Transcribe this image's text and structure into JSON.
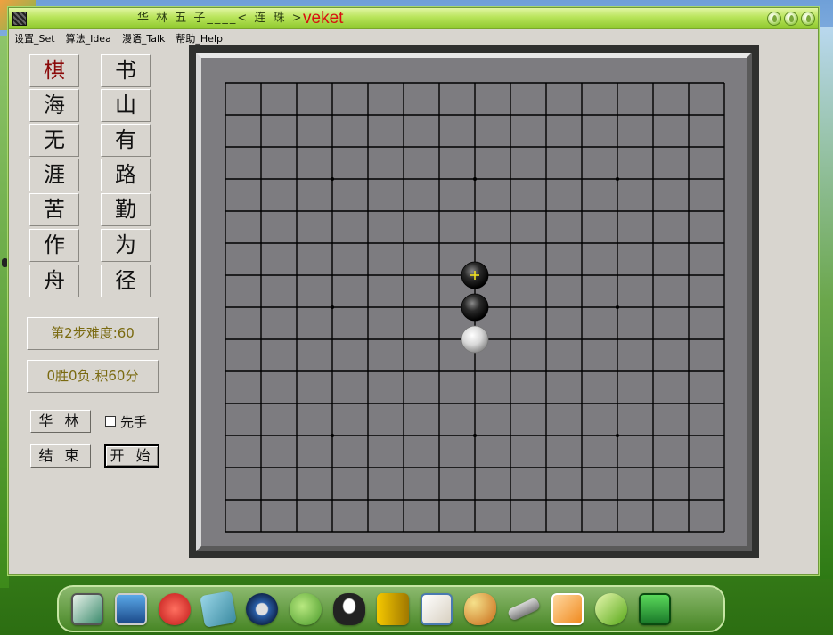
{
  "window": {
    "title": "华 林 五 子____< 连 珠 >",
    "brand": "veket"
  },
  "menu": [
    {
      "label": "设置_Set"
    },
    {
      "label": "算法_Idea"
    },
    {
      "label": "漫语_Talk"
    },
    {
      "label": "帮助_Help"
    }
  ],
  "tiles": {
    "left": [
      "棋",
      "海",
      "无",
      "涯",
      "苦",
      "作",
      "舟"
    ],
    "right": [
      "书",
      "山",
      "有",
      "路",
      "勤",
      "为",
      "径"
    ]
  },
  "status": {
    "difficulty": "第2步难度:60",
    "score": "0胜0负.积60分"
  },
  "controls": {
    "hualin_label": "华 林",
    "first_move_label": "先手",
    "first_move_checked": false,
    "end_label": "结 束",
    "start_label": "开 始"
  },
  "board": {
    "size": 15,
    "star_points": [
      [
        3,
        3
      ],
      [
        3,
        7
      ],
      [
        3,
        11
      ],
      [
        7,
        3
      ],
      [
        7,
        7
      ],
      [
        7,
        11
      ],
      [
        11,
        3
      ],
      [
        11,
        7
      ],
      [
        11,
        11
      ]
    ],
    "stones": [
      {
        "col": 7,
        "row": 6,
        "color": "black",
        "last_move": true
      },
      {
        "col": 7,
        "row": 7,
        "color": "black",
        "last_move": false
      },
      {
        "col": 7,
        "row": 8,
        "color": "white",
        "last_move": false
      }
    ],
    "colors": {
      "surface": "#7d7c80",
      "line": "#000000",
      "marker": "#f0e020"
    }
  },
  "dock": [
    {
      "icon": "drawing-app-icon"
    },
    {
      "icon": "computer-icon"
    },
    {
      "icon": "lobster-icon"
    },
    {
      "icon": "notepad-icon"
    },
    {
      "icon": "media-player-icon"
    },
    {
      "icon": "network-search-icon"
    },
    {
      "icon": "penguin-icon"
    },
    {
      "icon": "door-logout-icon"
    },
    {
      "icon": "presentation-icon"
    },
    {
      "icon": "paint-palette-icon"
    },
    {
      "icon": "usb-drive-icon"
    },
    {
      "icon": "tiger-picture-icon"
    },
    {
      "icon": "help-question-icon"
    },
    {
      "icon": "camera-icon"
    }
  ]
}
